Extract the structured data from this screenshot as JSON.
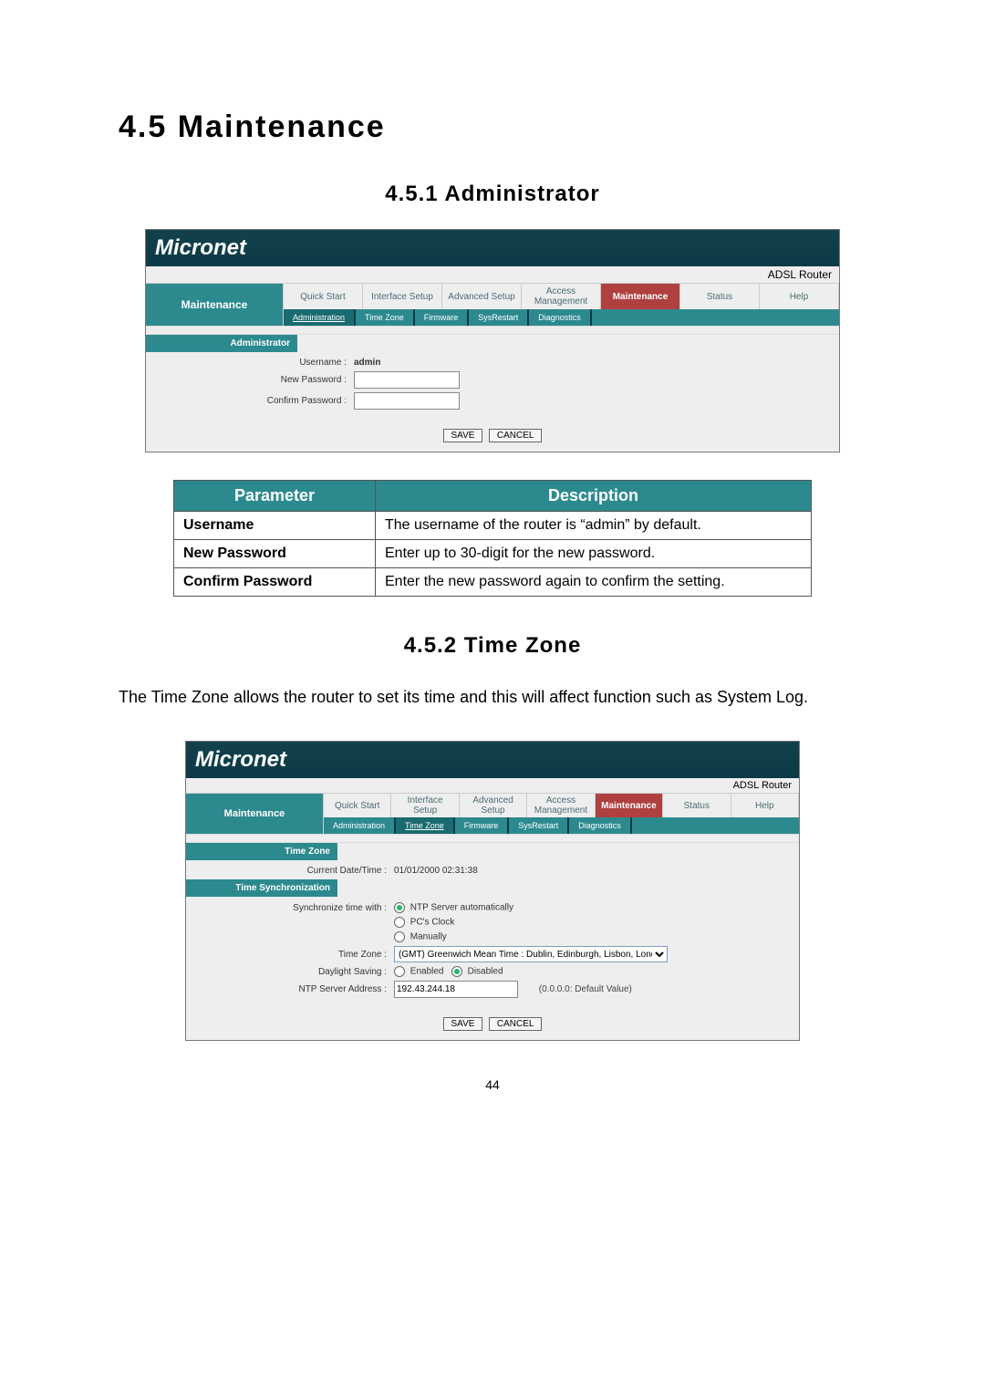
{
  "headings": {
    "h1": "4.5   Maintenance",
    "h2a": "4.5.1  Administrator",
    "h2b": "4.5.2  Time Zone"
  },
  "brand": "Micronet",
  "device": "ADSL Router",
  "leftcol": "Maintenance",
  "main_tabs": [
    "Quick Start",
    "Interface Setup",
    "Advanced Setup",
    "Access Management",
    "Maintenance",
    "Status",
    "Help"
  ],
  "sub_tabs": [
    "Administration",
    "Time Zone",
    "Firmware",
    "SysRestart",
    "Diagnostics"
  ],
  "section_admin": "Administrator",
  "admin_form": {
    "username_label": "Username :",
    "username_value": "admin",
    "newpass_label": "New Password :",
    "confirm_label": "Confirm Password :",
    "save": "SAVE",
    "cancel": "CANCEL"
  },
  "ptable": {
    "h_param": "Parameter",
    "h_desc": "Description",
    "rows": [
      {
        "p": "Username",
        "d": "The username of the router is “admin” by default."
      },
      {
        "p": "New Password",
        "d": "Enter up to 30-digit for the new password."
      },
      {
        "p": "Confirm Password",
        "d": "Enter the new password again to confirm the setting."
      }
    ]
  },
  "tz_intro": "The Time Zone allows the router to set its time and this will affect function such as System Log.",
  "section_tz": "Time Zone",
  "section_tsync": "Time Synchronization",
  "tz_form": {
    "curdt_label": "Current Date/Time :",
    "curdt_value": "01/01/2000 02:31:38",
    "sync_label": "Synchronize time with :",
    "sync_opt1": "NTP Server automatically",
    "sync_opt2": "PC's Clock",
    "sync_opt3": "Manually",
    "tz_label": "Time Zone :",
    "tz_value": "(GMT) Greenwich Mean Time : Dublin, Edinburgh, Lisbon, London",
    "ds_label": "Daylight Saving :",
    "ds_enabled": "Enabled",
    "ds_disabled": "Disabled",
    "ntp_label": "NTP Server Address :",
    "ntp_value": "192.43.244.18",
    "ntp_note": "(0.0.0.0: Default Value)",
    "save": "SAVE",
    "cancel": "CANCEL"
  },
  "page_number": "44"
}
